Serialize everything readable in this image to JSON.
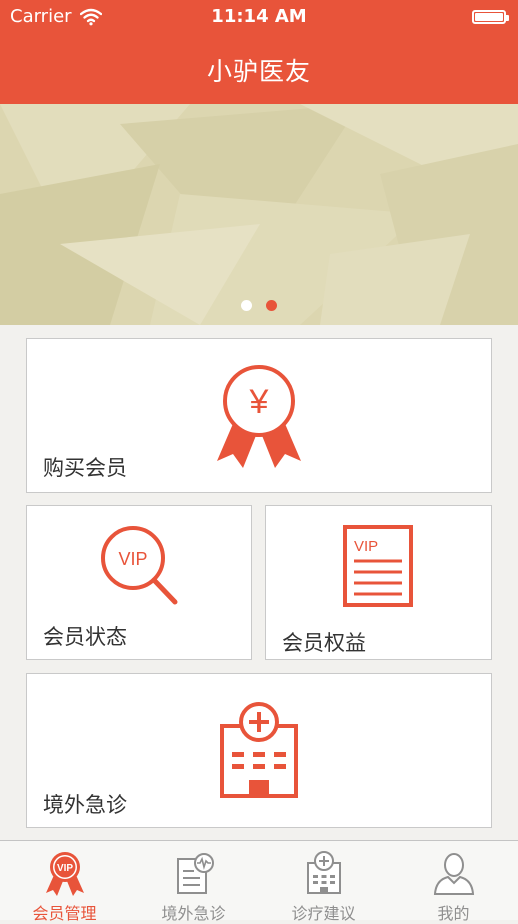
{
  "status_bar": {
    "carrier": "Carrier",
    "time": "11:14 AM"
  },
  "header": {
    "title": "小驴医友"
  },
  "banner": {
    "slide_count": 2,
    "active_slide": 2
  },
  "cards": {
    "buy": {
      "label": "购买会员",
      "icon": "award-yen-icon",
      "icon_symbol": "¥"
    },
    "status": {
      "label": "会员状态",
      "icon": "vip-magnifier-icon",
      "icon_text": "VIP"
    },
    "benefits": {
      "label": "会员权益",
      "icon": "vip-document-icon",
      "icon_text": "VIP"
    },
    "emergency": {
      "label": "境外急诊",
      "icon": "hospital-icon"
    }
  },
  "tabbar": {
    "tabs": [
      {
        "label": "会员管理",
        "icon": "vip-award-icon",
        "icon_text": "VIP",
        "active": true
      },
      {
        "label": "境外急诊",
        "icon": "medical-record-icon",
        "active": false
      },
      {
        "label": "诊疗建议",
        "icon": "hospital-icon",
        "active": false
      },
      {
        "label": "我的",
        "icon": "user-icon",
        "active": false
      }
    ]
  },
  "colors": {
    "accent": "#e8543a",
    "background": "#f2f1ee",
    "banner": "#dcd7b1",
    "tab_inactive": "#8f8f8f"
  }
}
